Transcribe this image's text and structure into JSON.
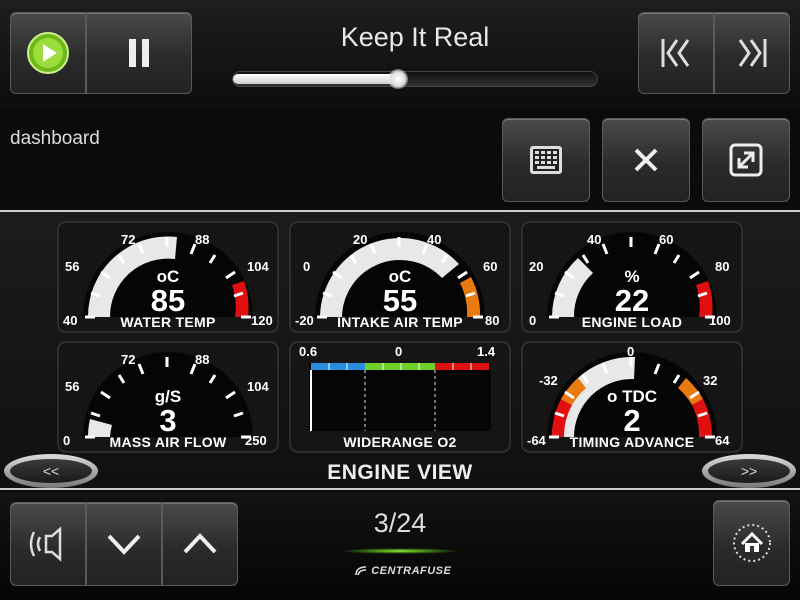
{
  "media": {
    "title": "Keep It Real",
    "progress": 0.45
  },
  "page": {
    "label": "dashboard",
    "count": "3/24",
    "brand": "CENTRAFUSE"
  },
  "dashboard": {
    "title": "ENGINE VIEW",
    "prev_label": "<<",
    "next_label": ">>",
    "gauges": [
      {
        "label": "WATER TEMP",
        "unit": "oC",
        "value": "85",
        "ticks": [
          "40",
          "56",
          "72",
          "88",
          "104",
          "120"
        ]
      },
      {
        "label": "INTAKE AIR TEMP",
        "unit": "oC",
        "value": "55",
        "ticks": [
          "-20",
          "0",
          "20",
          "40",
          "60",
          "80"
        ]
      },
      {
        "label": "ENGINE LOAD",
        "unit": "%",
        "value": "22",
        "ticks": [
          "0",
          "20",
          "40",
          "60",
          "80",
          "100"
        ]
      },
      {
        "label": "MASS AIR FLOW",
        "unit": "g/S",
        "value": "3",
        "ticks": [
          "0",
          "56",
          "72",
          "88",
          "104",
          "250"
        ]
      },
      {
        "label": "WIDERANGE O2",
        "ticks": [
          "0.6",
          "0",
          "1.4"
        ]
      },
      {
        "label": "TIMING ADVANCE",
        "unit": "o TDC",
        "value": "2",
        "ticks": [
          "-64",
          "-32",
          "0",
          "32",
          "64"
        ]
      }
    ]
  },
  "colors": {
    "accent": "#7fd41a",
    "red": "#e01010",
    "orange": "#e87a10"
  }
}
